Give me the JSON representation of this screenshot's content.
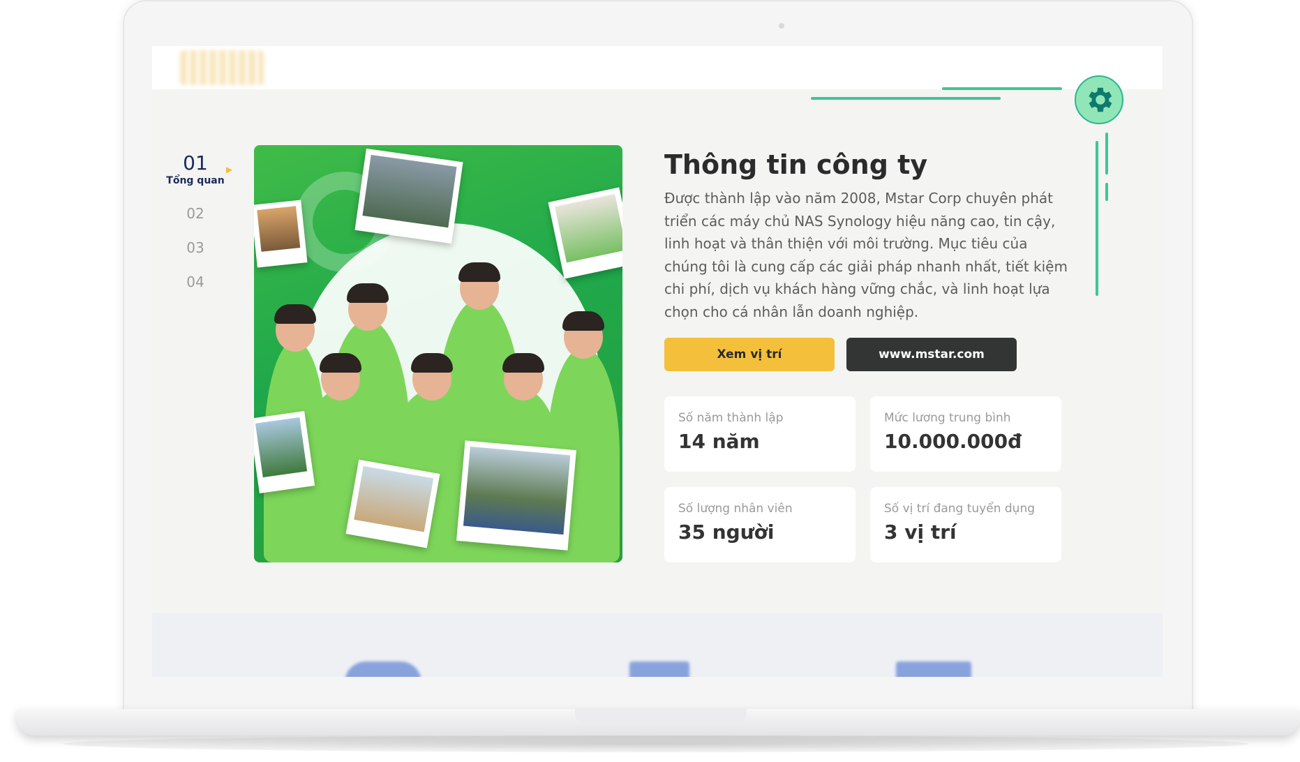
{
  "nav": {
    "steps": [
      {
        "number": "01",
        "label": "Tổng quan",
        "active": true
      },
      {
        "number": "02",
        "label": "",
        "active": false
      },
      {
        "number": "03",
        "label": "",
        "active": false
      },
      {
        "number": "04",
        "label": "",
        "active": false
      }
    ]
  },
  "company": {
    "title": "Thông tin công ty",
    "description": "Được thành lập vào năm 2008, Mstar Corp chuyên phát triển các máy chủ NAS Synology hiệu năng cao, tin cậy, linh hoạt và thân thiện với môi trường. Mục tiêu của chúng tôi là cung cấp các giải pháp nhanh nhất, tiết kiệm chi phí, dịch vụ khách hàng vững chắc, và linh hoạt lựa chọn cho cá nhân lẫn doanh nghiệp.",
    "buttons": {
      "location": "Xem vị trí",
      "website": "www.mstar.com"
    }
  },
  "stats": [
    {
      "label": "Số năm thành lập",
      "value": "14 năm"
    },
    {
      "label": "Mức lương trung bình",
      "value": "10.000.000đ"
    },
    {
      "label": "Số lượng nhân viên",
      "value": "35 người"
    },
    {
      "label": "Số vị trí đang tuyển dụng",
      "value": "3 vị trí"
    }
  ],
  "icons": {
    "settings": "gear-icon",
    "active_step": "triangle-right-icon"
  },
  "colors": {
    "accent_green": "#3cc59a",
    "yellow": "#f4bf3b",
    "dark": "#333535",
    "navy": "#1c2a5a"
  }
}
